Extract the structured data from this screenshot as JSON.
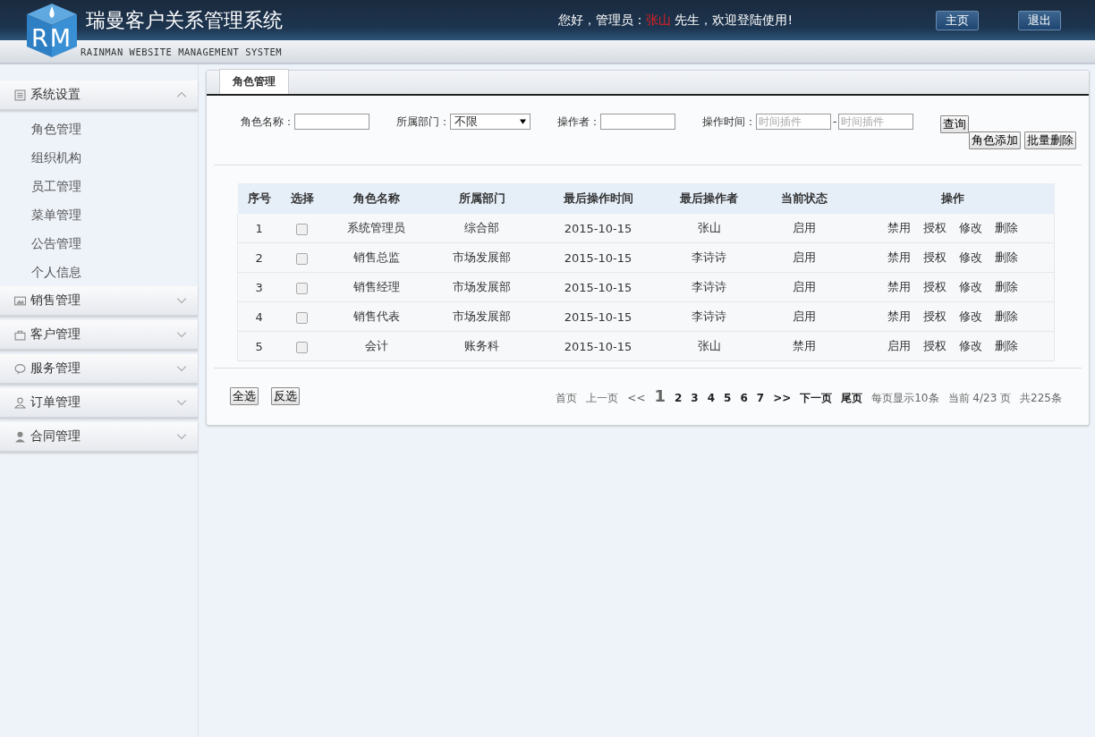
{
  "header": {
    "logo_letters": "RM",
    "title": "瑞曼客户关系管理系统",
    "subtitle": "RAINMAN WEBSITE MANAGEMENT SYSTEM",
    "greeting_before": "您好，管理员：",
    "user_name": "张山",
    "greeting_after": " 先生，欢迎登陆使用!",
    "buttons": [
      "主页",
      "退出"
    ]
  },
  "sidebar": {
    "groups": [
      {
        "label": "系统设置",
        "kind": "list",
        "expanded": true,
        "items": [
          {
            "label": "角色管理"
          },
          {
            "label": "组织机构"
          },
          {
            "label": "员工管理"
          },
          {
            "label": "菜单管理"
          },
          {
            "label": "公告管理"
          },
          {
            "label": "个人信息"
          }
        ]
      },
      {
        "label": "销售管理",
        "kind": "image",
        "expanded": false
      },
      {
        "label": "客户管理",
        "kind": "bag",
        "expanded": false
      },
      {
        "label": "服务管理",
        "kind": "chat",
        "expanded": false
      },
      {
        "label": "订单管理",
        "kind": "person-outline",
        "expanded": false
      },
      {
        "label": "合同管理",
        "kind": "person",
        "expanded": false
      }
    ]
  },
  "tabs": [
    {
      "label": "角色管理",
      "selected": true
    }
  ],
  "filters": {
    "role_name_label": "角色名称：",
    "department_label": "所属部门：",
    "department_value": "不限",
    "operator_label": "操作者：",
    "time_label": "操作时间：",
    "time_from_placeholder": "时间插件",
    "separator": "-",
    "time_to_placeholder": "时间插件",
    "search_button": "查询",
    "add_button": "角色添加",
    "batch_delete_button": "批量删除"
  },
  "table": {
    "columns": [
      "序号",
      "选择",
      "角色名称",
      "所属部门",
      "最后操作时间",
      "最后操作者",
      "当前状态",
      "操作"
    ],
    "rows": [
      {
        "no": "1",
        "checked": false,
        "name": "系统管理员",
        "department": "综合部",
        "time": "2015-10-15",
        "operator": "张山",
        "status": "启用",
        "actions": [
          "禁用",
          "授权",
          "修改",
          "删除"
        ]
      },
      {
        "no": "2",
        "checked": false,
        "name": "销售总监",
        "department": "市场发展部",
        "time": "2015-10-15",
        "operator": "李诗诗",
        "status": "启用",
        "actions": [
          "禁用",
          "授权",
          "修改",
          "删除"
        ]
      },
      {
        "no": "3",
        "checked": false,
        "name": "销售经理",
        "department": "市场发展部",
        "time": "2015-10-15",
        "operator": "李诗诗",
        "status": "启用",
        "actions": [
          "禁用",
          "授权",
          "修改",
          "删除"
        ]
      },
      {
        "no": "4",
        "checked": false,
        "name": "销售代表",
        "department": "市场发展部",
        "time": "2015-10-15",
        "operator": "李诗诗",
        "status": "启用",
        "actions": [
          "禁用",
          "授权",
          "修改",
          "删除"
        ]
      },
      {
        "no": "5",
        "checked": false,
        "name": "会计",
        "department": "账务科",
        "time": "2015-10-15",
        "operator": "张山",
        "status": "禁用",
        "actions": [
          "启用",
          "授权",
          "修改",
          "删除"
        ]
      }
    ]
  },
  "footer": {
    "buttons": [
      "全选",
      "反选"
    ],
    "pager_before": [
      {
        "label": "首页",
        "strong": false
      },
      {
        "label": "上一页",
        "strong": false
      },
      {
        "label": "<<",
        "strong": false
      }
    ],
    "pages": [
      {
        "label": "1",
        "selected": true
      },
      {
        "label": "2",
        "selected": false
      },
      {
        "label": "3",
        "selected": false
      },
      {
        "label": "4",
        "selected": false
      },
      {
        "label": "5",
        "selected": false
      },
      {
        "label": "6",
        "selected": false
      },
      {
        "label": "7",
        "selected": false
      }
    ],
    "pager_after": [
      {
        "label": ">>",
        "strong": true
      },
      {
        "label": "下一页",
        "strong": true
      },
      {
        "label": "尾页",
        "strong": true
      }
    ],
    "info": [
      "每页显示10条",
      "当前 4/23 页",
      "共225条"
    ]
  }
}
